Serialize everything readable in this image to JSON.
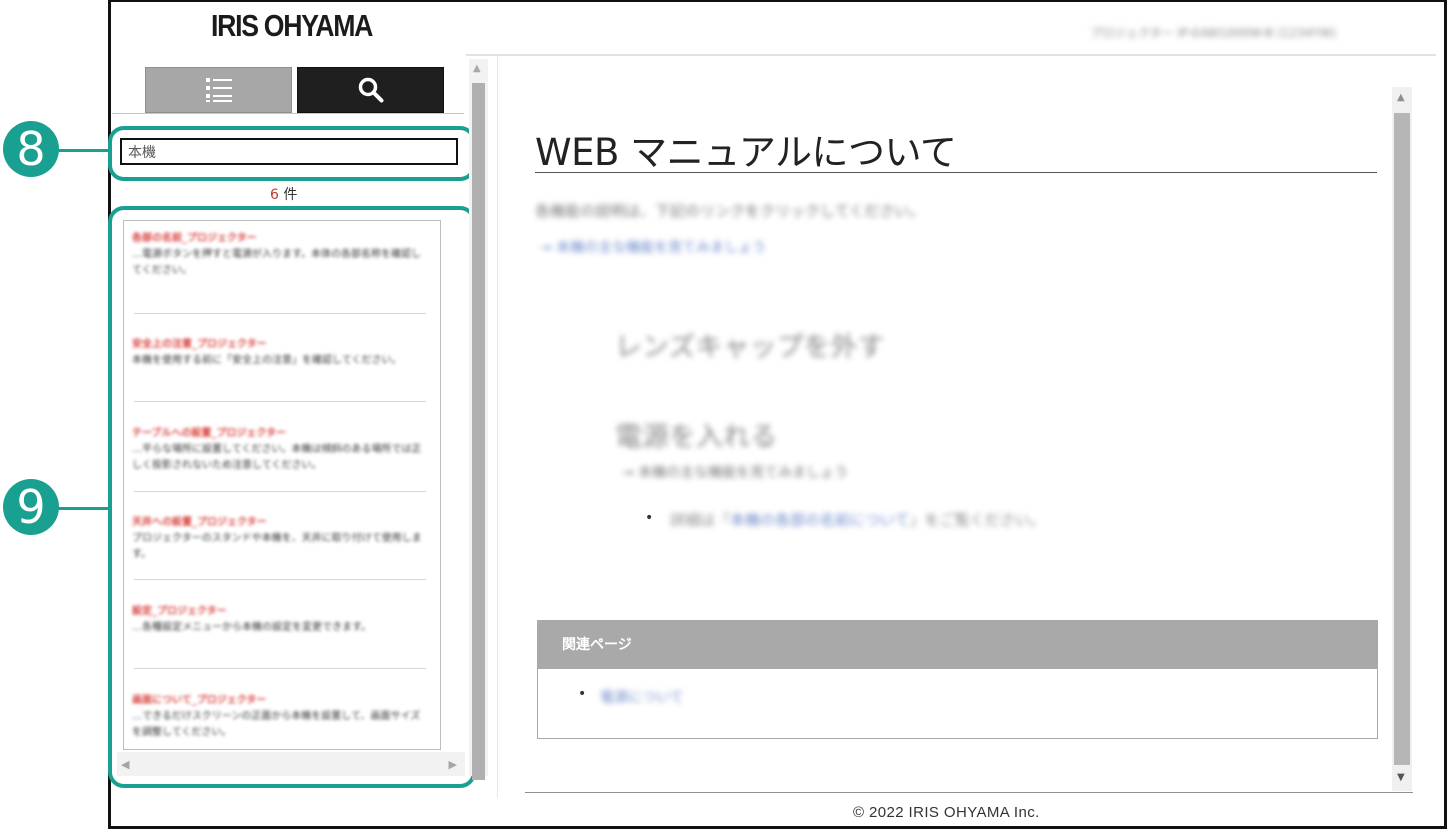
{
  "header": {
    "logo": "IRIS OHYAMA",
    "doc_title": "プロジェクター IP-EAW1000W-B (1234YW)"
  },
  "sidebar": {
    "tabs": [
      {
        "name": "list",
        "icon": "list-icon"
      },
      {
        "name": "search",
        "icon": "search-icon",
        "active": true
      }
    ],
    "search": {
      "value": "本機"
    },
    "result_count": {
      "number": "6",
      "unit": "件"
    },
    "results": [
      {
        "title": "各部の名前_プロジェクター",
        "snippet": "…電源ボタンを押すと電源が入ります。本体の各部名称を確認してください。"
      },
      {
        "title": "安全上の注意_プロジェクター",
        "snippet": "本機を使用する前に「安全上の注意」を確認してください。"
      },
      {
        "title": "テーブルへの設置_プロジェクター",
        "snippet": "…平らな場所に設置してください。本機は傾斜のある場所では正しく投影されないため注意してください。"
      },
      {
        "title": "天井への設置_プロジェクター",
        "snippet": "プロジェクターのスタンドや本機を、天井に取り付けて使用します。"
      },
      {
        "title": "設定_プロジェクター",
        "snippet": "…各種設定メニューから本機の設定を変更できます。"
      },
      {
        "title": "画面について_プロジェクター",
        "snippet": "…できるだけスクリーンの正面から本機を設置して、画面サイズを調整してください。"
      }
    ],
    "callouts": [
      "8",
      "9"
    ]
  },
  "content": {
    "title": "WEB マニュアルについて",
    "intro": "各機能の説明は、下記のリンクをクリックしてください。",
    "intro_link": "→ 本機の主な機能を見てみましょう",
    "section1": "レンズキャップを外す",
    "section2": "電源を入れる",
    "section2_note": "→ 本機の主な機能を見てみましょう",
    "bullet_text": "詳細は「",
    "bullet_link": "本機の各部の名前について",
    "bullet_tail": "」をご覧ください。",
    "related": {
      "heading": "関連ページ",
      "link": "電源について"
    }
  },
  "footer": {
    "copyright": "© 2022 IRIS OHYAMA Inc."
  },
  "colors": {
    "accent": "#1aa090",
    "highlight_red": "#d8433f",
    "link": "#6a87c8"
  }
}
